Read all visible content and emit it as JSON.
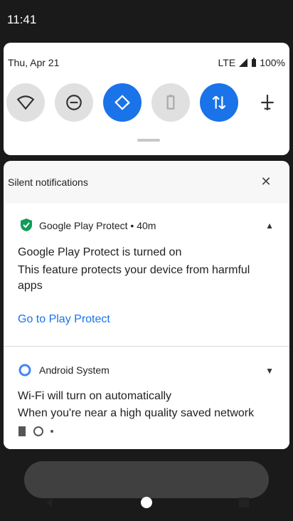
{
  "status_bar": {
    "time": "11:41"
  },
  "quick_settings": {
    "date": "Thu, Apr 21",
    "network": "LTE",
    "battery": "100%",
    "tiles": [
      {
        "name": "wifi",
        "icon": "wifi-icon",
        "state": "off"
      },
      {
        "name": "do-not-disturb",
        "icon": "do-not-disturb-icon",
        "state": "off"
      },
      {
        "name": "auto-rotate",
        "icon": "auto-rotate-icon",
        "state": "on"
      },
      {
        "name": "battery-saver",
        "icon": "battery-saver-icon",
        "state": "off"
      },
      {
        "name": "mobile-data",
        "icon": "mobile-data-icon",
        "state": "on"
      },
      {
        "name": "airplane-mode",
        "icon": "airplane-icon",
        "state": "none"
      }
    ]
  },
  "notifications": {
    "section_title": "Silent notifications",
    "items": [
      {
        "app": "Google Play Protect",
        "time": "40m",
        "title": "Google Play Protect is turned on",
        "text": "This feature protects your device from harmful apps",
        "action": "Go to Play Protect"
      },
      {
        "app": "Android System",
        "title": "Wi-Fi will turn on automatically",
        "text": "When you're near a high quality saved network"
      }
    ]
  },
  "colors": {
    "accent": "#1a73e8",
    "tile_off": "#e0e0e0"
  }
}
